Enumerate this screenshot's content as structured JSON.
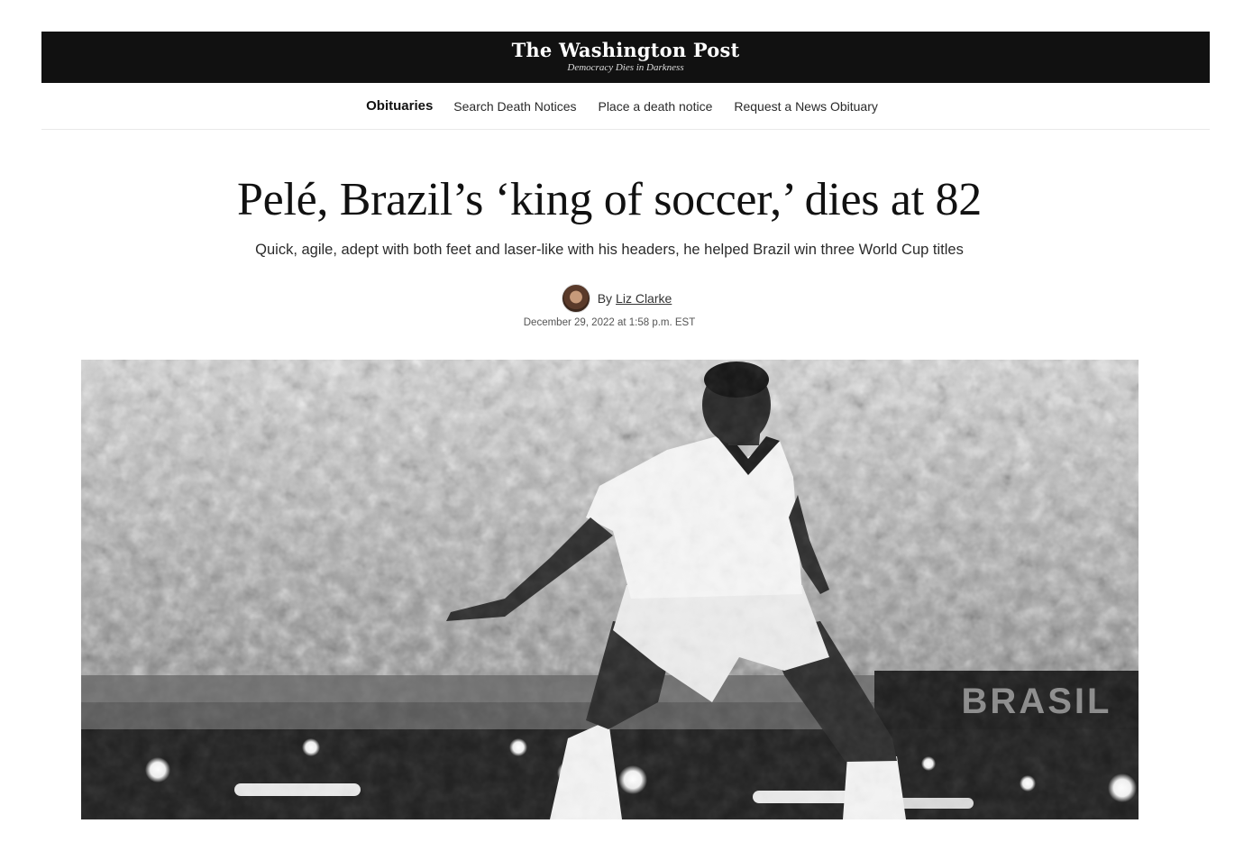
{
  "masthead": {
    "logo": "The Washington Post",
    "tagline": "Democracy Dies in Darkness"
  },
  "subnav": {
    "section": "Obituaries",
    "links": [
      "Search Death Notices",
      "Place a death notice",
      "Request a News Obituary"
    ]
  },
  "article": {
    "headline": "Pelé, Brazil’s ‘king of soccer,’ dies at 82",
    "dek": "Quick, agile, adept with both feet and laser-like with his headers, he helped Brazil win three World Cup titles",
    "byline_prefix": "By",
    "author": "Liz Clarke",
    "timestamp": "December 29, 2022 at 1:58 p.m. EST"
  },
  "photo": {
    "banner_text": "BRASIL",
    "style": "black-and-white"
  }
}
